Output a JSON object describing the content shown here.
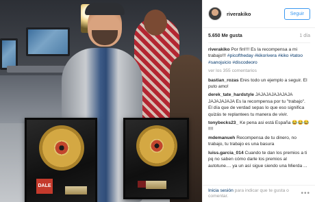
{
  "header": {
    "username": "riverakiko",
    "follow_label": "Seguir"
  },
  "stats": {
    "likes": "5.650 Me gusta",
    "time": "1 día"
  },
  "caption": {
    "author": "riverakiko",
    "text": " Por fin!!!! Es la recompensa a mi trabajo!!!",
    "tags": [
      "#picoftheday",
      "#kikorivera",
      "#kiko",
      "#tatoo",
      "#sanojuicio",
      "#discodeoro"
    ]
  },
  "view_all_label": "ver los 355 comentarios",
  "comments": [
    {
      "author": "bastian_rozas",
      "text": " Eres todo un ejemplo a seguir. El puto amo!"
    },
    {
      "author": "derek_tate_hardstyle",
      "text": " JAJAJAJAJAJAJA JAJAJAJAJA Es la recompensa por tu \"trabajo\". El día que de verdad sepas lo que eso significa quizás te replantees tu manera de vivir."
    },
    {
      "author": "tonybecks23_",
      "text": " Ke pena asi está España 😂😂😂 !!!!"
    },
    {
      "author": "mdemanueh",
      "text": " Recompensa de tu dinero, no trabajo, tu trabajo es una basura"
    },
    {
      "author": "luiss.garcia_014",
      "text": " Cuando te dan los premios a ti pq no saben cómo darle los premios al autotune.... ya un así sigue siendo una Mierda ..."
    }
  ],
  "footer": {
    "login_label": "Inicia sesión",
    "suffix": " para indicar que te gusta o comentar.",
    "more_label": "•••"
  },
  "photo": {
    "left_plaque_sticker": "DALE",
    "colors": {
      "gold": "#d4a843",
      "plaque": "#111111",
      "shirt_blue": "#2f4c78",
      "jacket_gray": "#c9ccd0"
    }
  },
  "colors": {
    "link_blue": "#3897f0",
    "tag_navy": "#003569",
    "muted": "#999999",
    "text": "#262626"
  }
}
